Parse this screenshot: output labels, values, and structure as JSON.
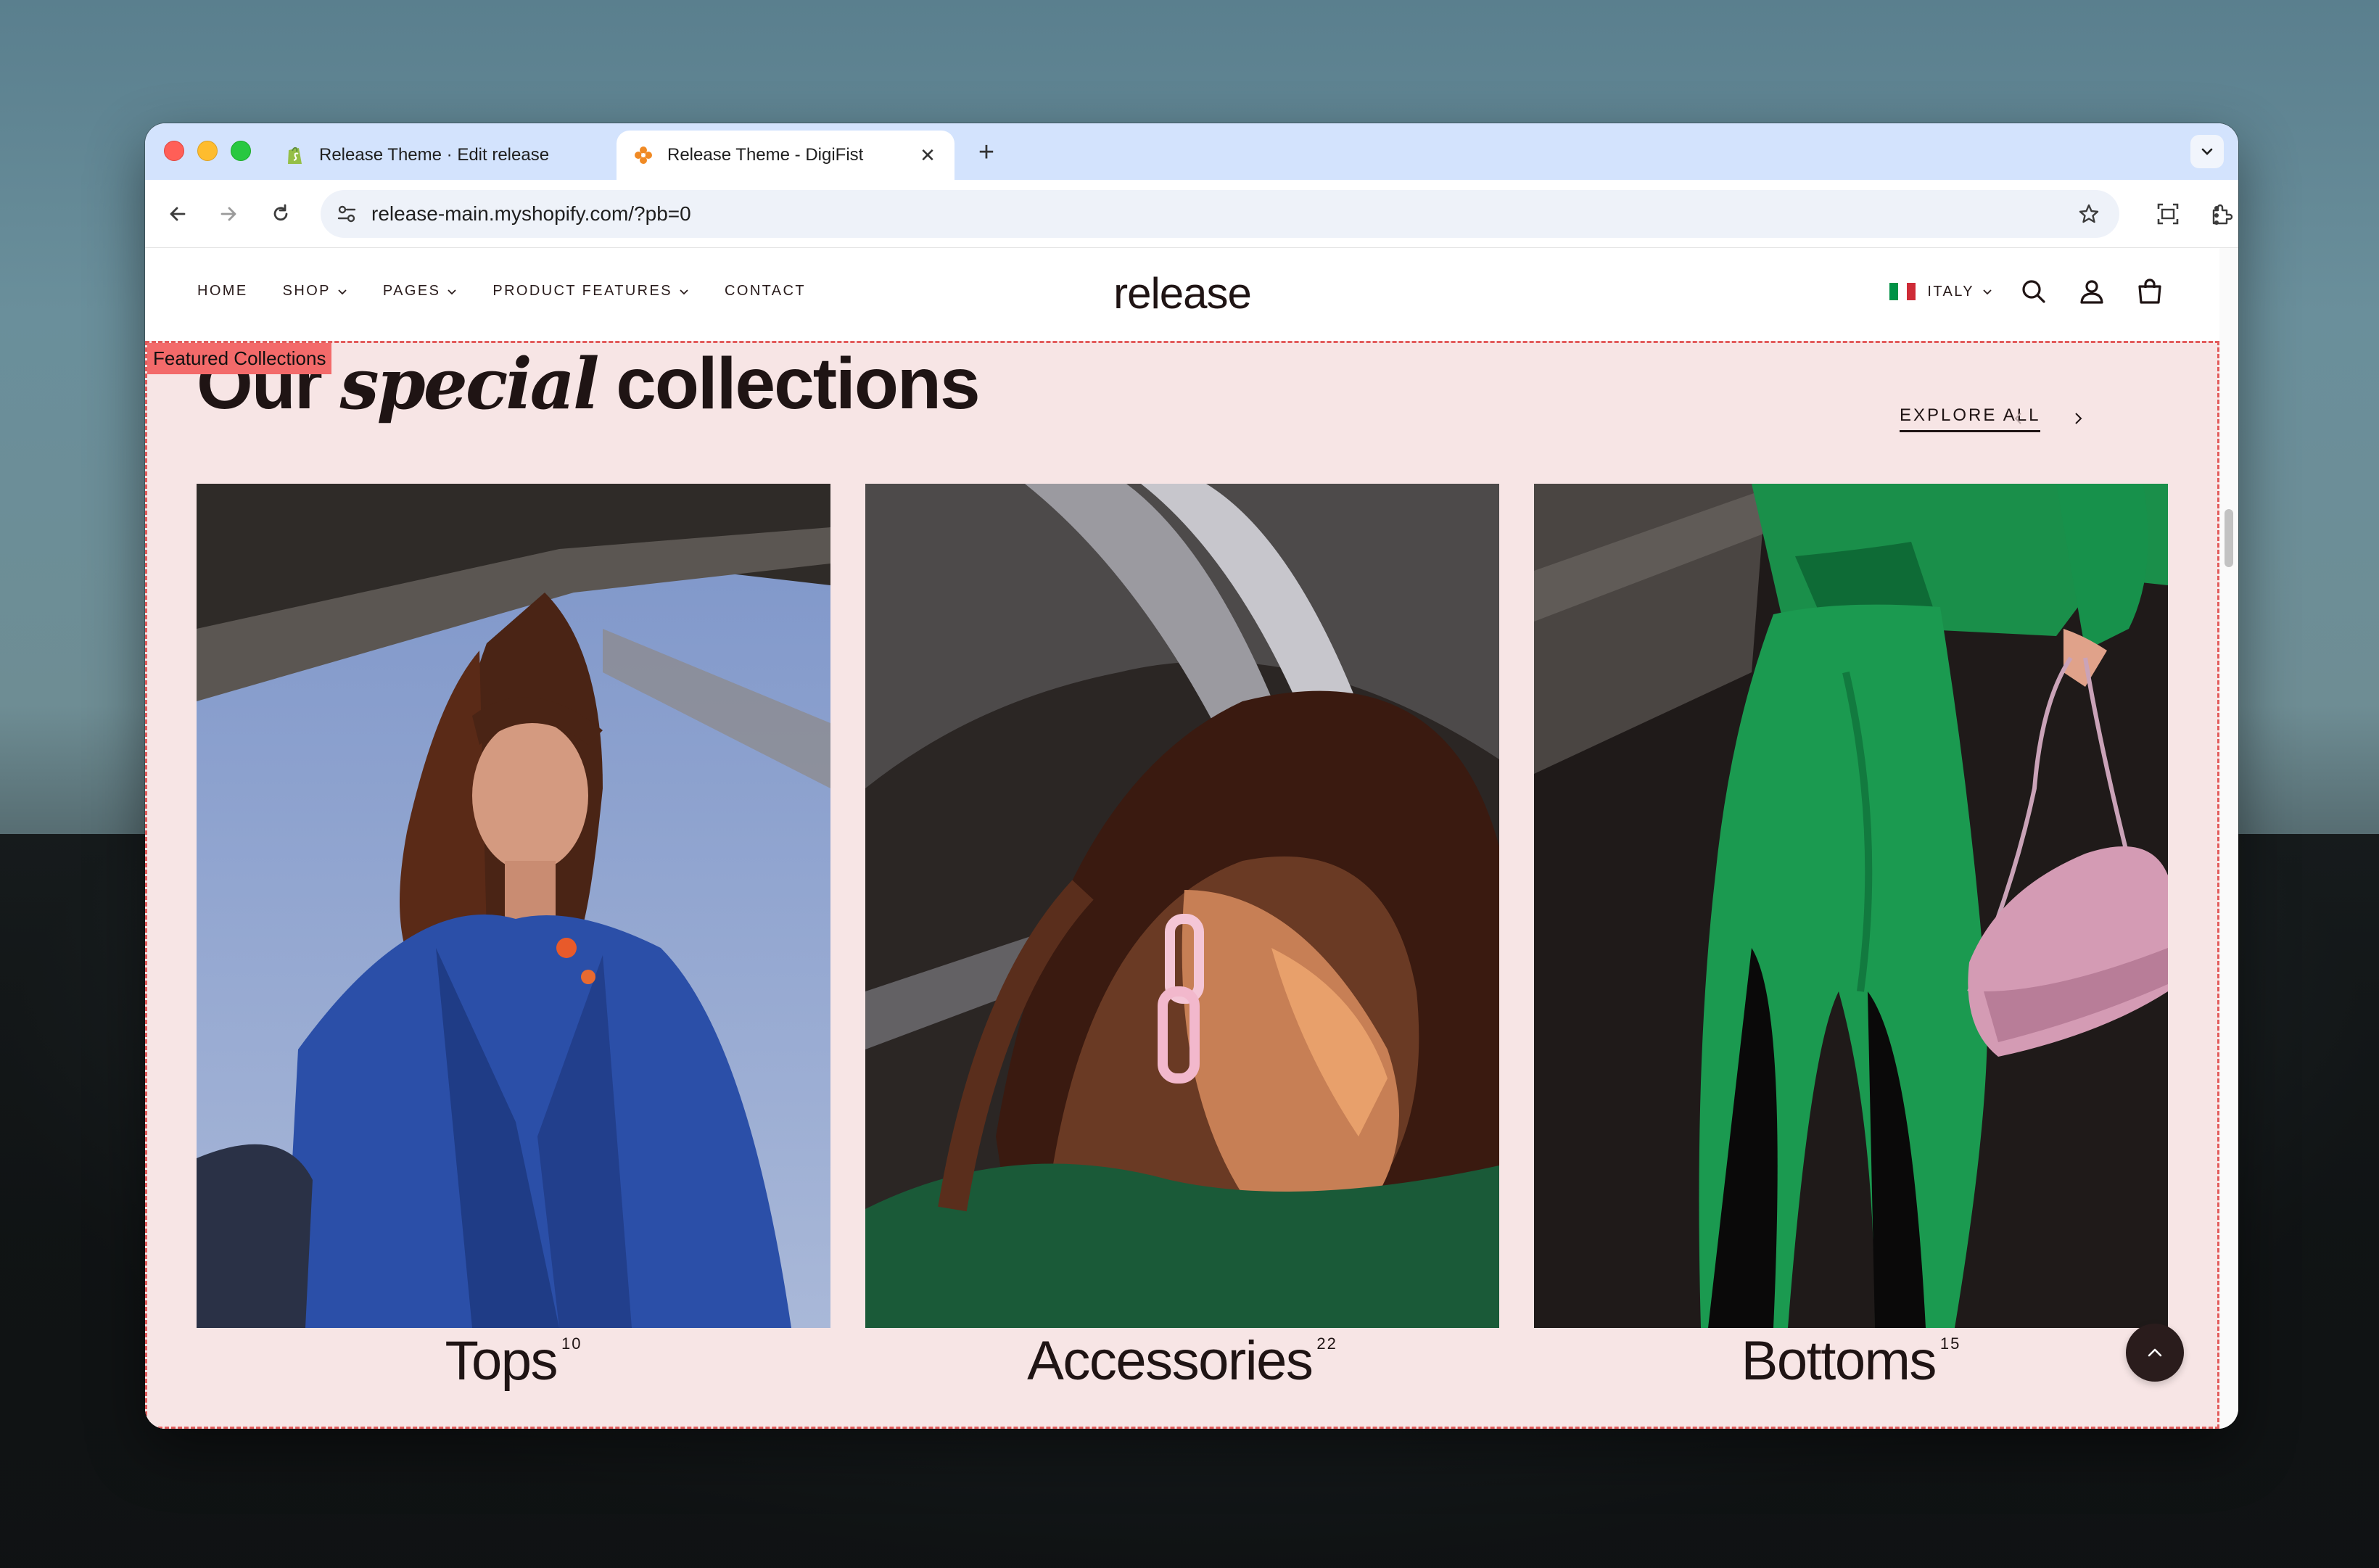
{
  "browser": {
    "tabs": [
      {
        "title": "Release Theme · Edit release",
        "favicon": "shopify-icon",
        "active": false
      },
      {
        "title": "Release Theme - DigiFist",
        "favicon": "digifist-icon",
        "active": true
      }
    ],
    "new_tab_label": "+",
    "address_bar": {
      "url": "release-main.myshopify.com/?pb=0"
    }
  },
  "site": {
    "nav": [
      {
        "label": "HOME",
        "has_dropdown": false
      },
      {
        "label": "SHOP",
        "has_dropdown": true
      },
      {
        "label": "PAGES",
        "has_dropdown": true
      },
      {
        "label": "PRODUCT FEATURES",
        "has_dropdown": true
      },
      {
        "label": "CONTACT",
        "has_dropdown": false
      }
    ],
    "logo": "release",
    "country": {
      "label": "ITALY",
      "flag": "italy-flag"
    },
    "header_icons": [
      "search-icon",
      "account-icon",
      "cart-icon"
    ]
  },
  "section": {
    "tag": "Featured Collections",
    "title_prefix": "Our",
    "title_italic": "special",
    "title_suffix": "collections",
    "explore_label": "EXPLORE ALL",
    "collections": [
      {
        "name": "Tops",
        "count": "10",
        "image": "woman in blue blazer"
      },
      {
        "name": "Accessories",
        "count": "22",
        "image": "woman with pink chain earring"
      },
      {
        "name": "Bottoms",
        "count": "15",
        "image": "green trousers with pink handbag"
      }
    ]
  },
  "colors": {
    "section_bg": "#f7e5e5",
    "section_outline": "#e25b5b",
    "text_dark": "#1f1414",
    "tab_strip": "#d3e3fd"
  }
}
